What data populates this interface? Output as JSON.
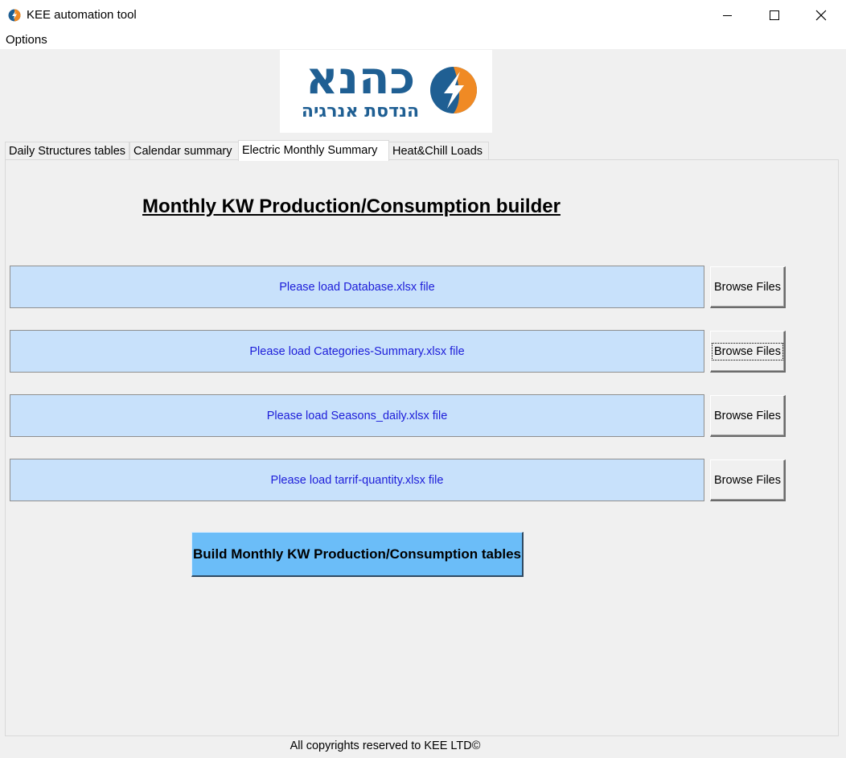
{
  "window": {
    "title": "KEE automation tool",
    "minimize_icon": "minimize-icon",
    "maximize_icon": "maximize-icon",
    "close_icon": "close-icon"
  },
  "menu": {
    "items": [
      "Options"
    ]
  },
  "logo": {
    "main_text": "כהנא",
    "sub_text": "הנדסת אנרגיה",
    "icon": "lightning-bolt-icon",
    "colors": {
      "text": "#1f5f93",
      "accent": "#f08a24"
    }
  },
  "tabs": [
    {
      "label": "Daily Structures tables",
      "active": false
    },
    {
      "label": "Calendar summary",
      "active": false
    },
    {
      "label": "Electric Monthly Summary",
      "active": true
    },
    {
      "label": "Heat&Chill Loads",
      "active": false
    }
  ],
  "main": {
    "heading": "Monthly KW Production/Consumption builder",
    "file_rows": [
      {
        "label": "Please load Database.xlsx file",
        "button": "Browse Files"
      },
      {
        "label": "Please load Categories-Summary.xlsx file",
        "button": "Browse Files"
      },
      {
        "label": "Please load Seasons_daily.xlsx file",
        "button": "Browse Files"
      },
      {
        "label": "Please load tarrif-quantity.xlsx file",
        "button": "Browse Files"
      }
    ],
    "build_button": "Build Monthly KW Production/Consumption tables"
  },
  "footer": {
    "text": "All copyrights reserved to KEE LTD©"
  },
  "colors": {
    "file_label_bg": "#c8e1fb",
    "file_label_text": "#1d1dd9",
    "build_button_bg": "#6bbdf8",
    "window_bg": "#f0f0f0"
  }
}
